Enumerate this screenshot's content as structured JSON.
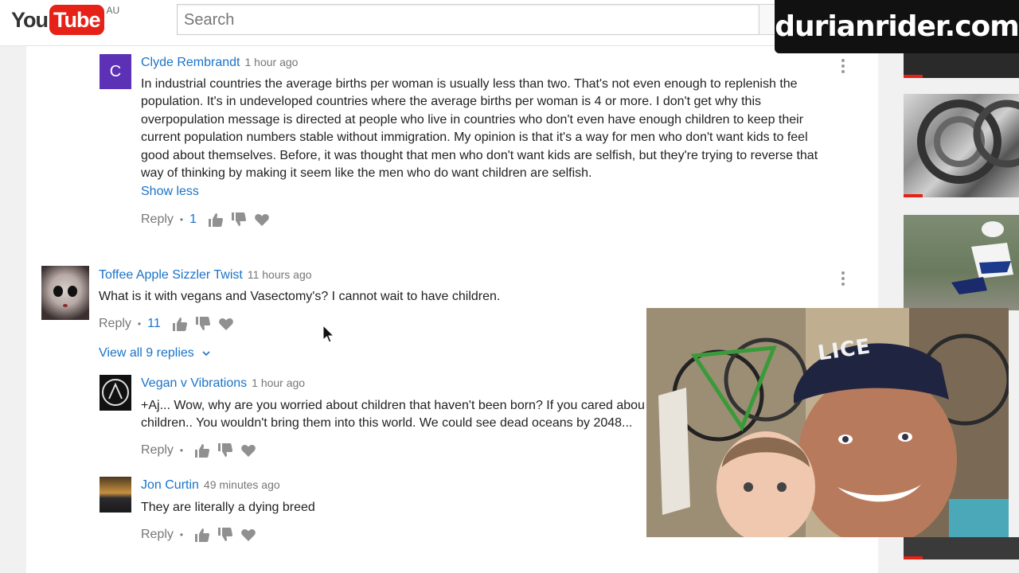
{
  "header": {
    "logo_you": "You",
    "logo_tube": "Tube",
    "region": "AU",
    "search_placeholder": "Search",
    "watermark": "durianrider.com"
  },
  "comments": [
    {
      "author": "Clyde Rembrandt",
      "time": "1 hour ago",
      "avatar_letter": "C",
      "avatar_color": "#5c31b5",
      "lines": [
        "In industrial countries the average births per woman is usually less than two.  That's not even enough to replenish the",
        "population.  It's in undeveloped countries where the average births per woman is 4 or more. I don't get why this",
        "overpopulation message is directed at people who live in countries who don't even have enough children to keep their",
        "current population numbers stable without immigration.  My opinion is that it's a way for men who don't want kids to feel",
        "good about themselves.  Before, it was thought that men who don't want kids are selfish, but they're trying to reverse that",
        "way of thinking by making it seem like the men who do want children are selfish."
      ],
      "show_less": "Show less",
      "reply": "Reply",
      "likes": "1"
    },
    {
      "author": "Toffee Apple Sizzler Twist",
      "time": "11 hours ago",
      "text": "What is it with vegans and Vasectomy's? I cannot wait to have children.",
      "reply": "Reply",
      "likes": "11",
      "view_replies": "View all 9 replies"
    }
  ],
  "replies": [
    {
      "author": "Vegan v Vibrations",
      "time": "1 hour ago",
      "lines": [
        "+Aj... Wow, why are you worried about children that haven't been born? If you cared abou",
        "children.. You wouldn't bring them into this world. We could see dead oceans by 2048..."
      ],
      "reply": "Reply"
    },
    {
      "author": "Jon Curtin",
      "time": "49 minutes ago",
      "text": "They are literally a dying breed",
      "reply": "Reply"
    }
  ],
  "webcam": {
    "cap_text": "LICE"
  },
  "colors": {
    "brand_red": "#e62117",
    "link_blue": "#1a73c8"
  }
}
